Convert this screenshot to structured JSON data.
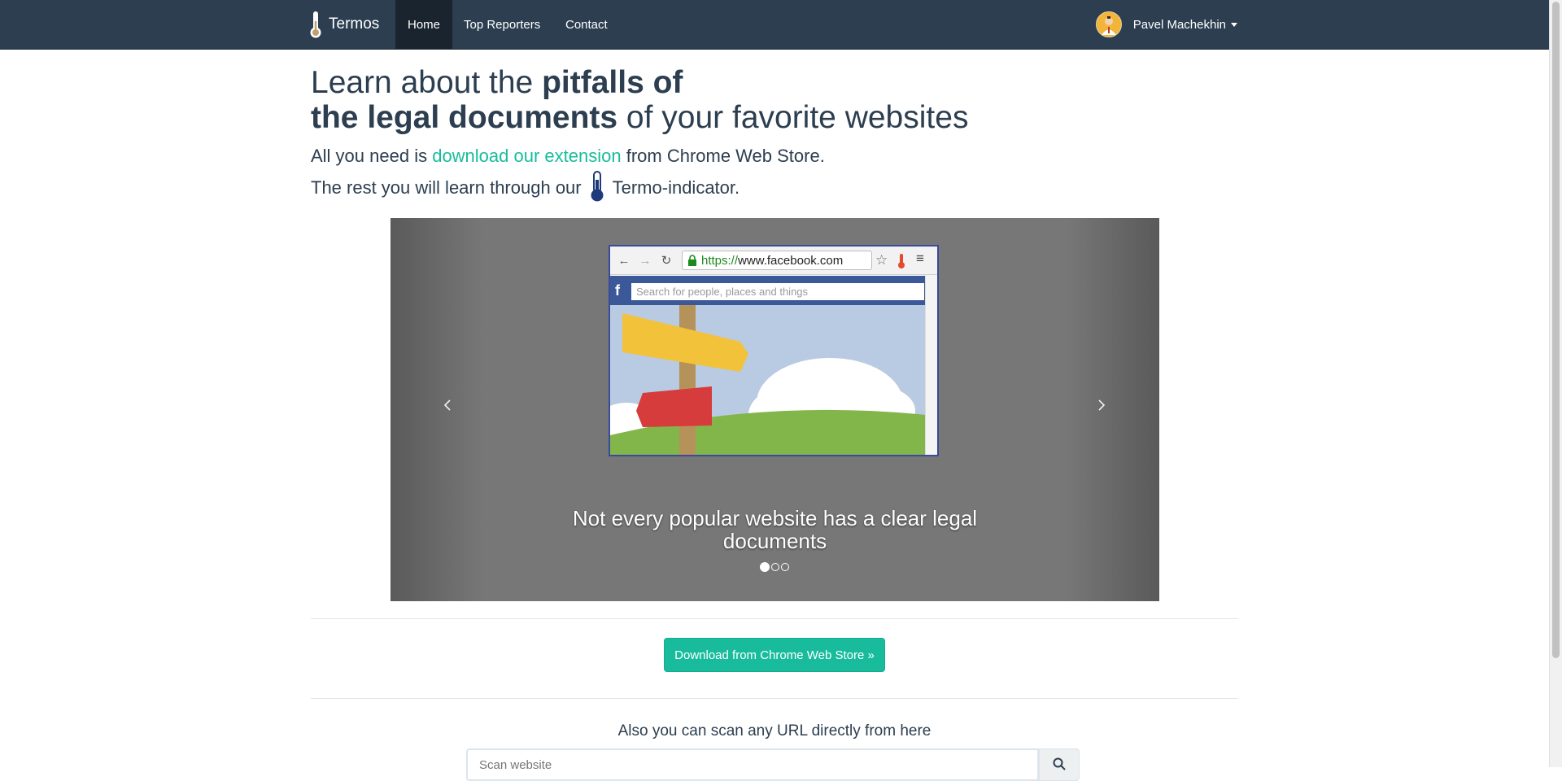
{
  "navbar": {
    "brand": "Termos",
    "items": [
      {
        "label": "Home",
        "active": true
      },
      {
        "label": "Top Reporters",
        "active": false
      },
      {
        "label": "Contact",
        "active": false
      }
    ],
    "user_name": "Pavel Machekhin"
  },
  "hero": {
    "title_part1": "Learn about the ",
    "title_bold1": "pitfalls of",
    "title_bold2": "the legal documents",
    "title_part2": " of your favorite websites",
    "line1_prefix": "All you need is ",
    "line1_link": "download our extension",
    "line1_suffix": " from Chrome Web Store.",
    "line2_prefix": "The rest you will learn through our",
    "line2_suffix": "Termo-indicator."
  },
  "carousel": {
    "caption": "Not every popular website has a clear legal documents",
    "slide_count": 3,
    "active_slide": 1,
    "mock_browser": {
      "url_https": "https://",
      "url_rest": "www.facebook.com",
      "search_placeholder": "Search for people, places and things"
    }
  },
  "download_button": "Download from Chrome Web Store »",
  "scan": {
    "title": "Also you can scan any URL directly from here",
    "placeholder": "Scan website"
  },
  "colors": {
    "navbar": "#2c3e50",
    "accent": "#18bc9c",
    "text": "#2c3e50"
  }
}
